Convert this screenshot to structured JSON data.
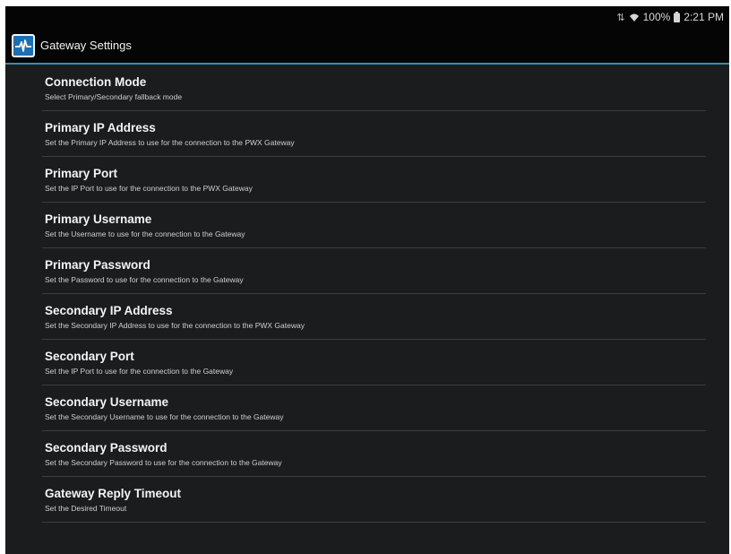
{
  "status_bar": {
    "battery": "100%",
    "time": "2:21 PM",
    "icons": [
      "mute-icon",
      "wifi-icon",
      "battery-icon"
    ]
  },
  "app": {
    "title": "Gateway Settings",
    "accent_color": "#3a8bb3",
    "icon": "app-logo-icon"
  },
  "settings": [
    {
      "title": "Connection Mode",
      "description": "Select Primary/Secondary fallback mode"
    },
    {
      "title": "Primary IP Address",
      "description": "Set the Primary IP Address to use for the connection to the PWX Gateway"
    },
    {
      "title": "Primary Port",
      "description": "Set the IP Port to use for the connection to the PWX Gateway"
    },
    {
      "title": "Primary Username",
      "description": "Set the Username to use for the connection to the Gateway"
    },
    {
      "title": "Primary Password",
      "description": "Set the Password to use for the connection to the Gateway"
    },
    {
      "title": "Secondary IP Address",
      "description": "Set the Secondary IP Address to use for the connection to the PWX Gateway"
    },
    {
      "title": "Secondary Port",
      "description": "Set the IP Port to use for the connection to the Gateway"
    },
    {
      "title": "Secondary Username",
      "description": "Set the Secondary Username to use for the connection to the Gateway"
    },
    {
      "title": "Secondary Password",
      "description": "Set the Secondary Password to use for the connection to the Gateway"
    },
    {
      "title": "Gateway Reply Timeout",
      "description": "Set the Desired Timeout"
    }
  ]
}
